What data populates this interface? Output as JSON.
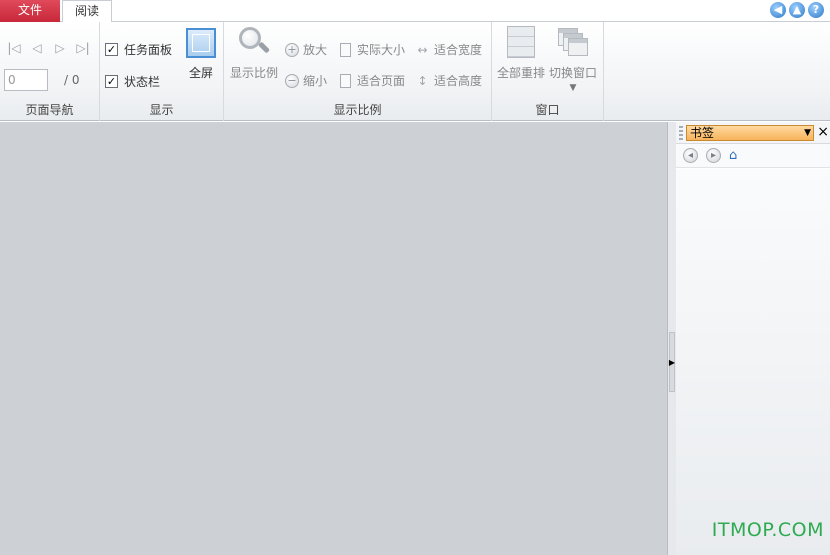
{
  "tabs": {
    "file": "文件",
    "read": "阅读"
  },
  "window_buttons": [
    {
      "icon": "back-icon",
      "glyph": "◀"
    },
    {
      "icon": "up-icon",
      "glyph": "▲"
    },
    {
      "icon": "help-icon",
      "glyph": "?"
    }
  ],
  "ribbon": {
    "nav": {
      "label": "页面导航",
      "page_value": "0",
      "page_total": "/ 0",
      "icons": [
        "first-page-icon",
        "prev-page-icon",
        "next-page-icon",
        "last-page-icon"
      ]
    },
    "show": {
      "label": "显示",
      "task_panel": "任务面板",
      "status_bar": "状态栏",
      "fullscreen": "全屏",
      "task_panel_checked": true,
      "status_bar_checked": true
    },
    "zoom": {
      "label": "显示比例",
      "zoom_ratio": "显示比例",
      "zoom_in": "放大",
      "zoom_out": "缩小",
      "actual_size": "实际大小",
      "fit_page": "适合页面",
      "fit_width": "适合宽度",
      "fit_height": "适合高度"
    },
    "window": {
      "label": "窗口",
      "rearrange": "全部重排",
      "switch": "切换窗口"
    }
  },
  "panel": {
    "select_value": "书签",
    "close": "×",
    "tools": [
      "prev-bookmark-icon",
      "next-bookmark-icon",
      "home-icon"
    ]
  },
  "watermark": "ITMOP.COM"
}
